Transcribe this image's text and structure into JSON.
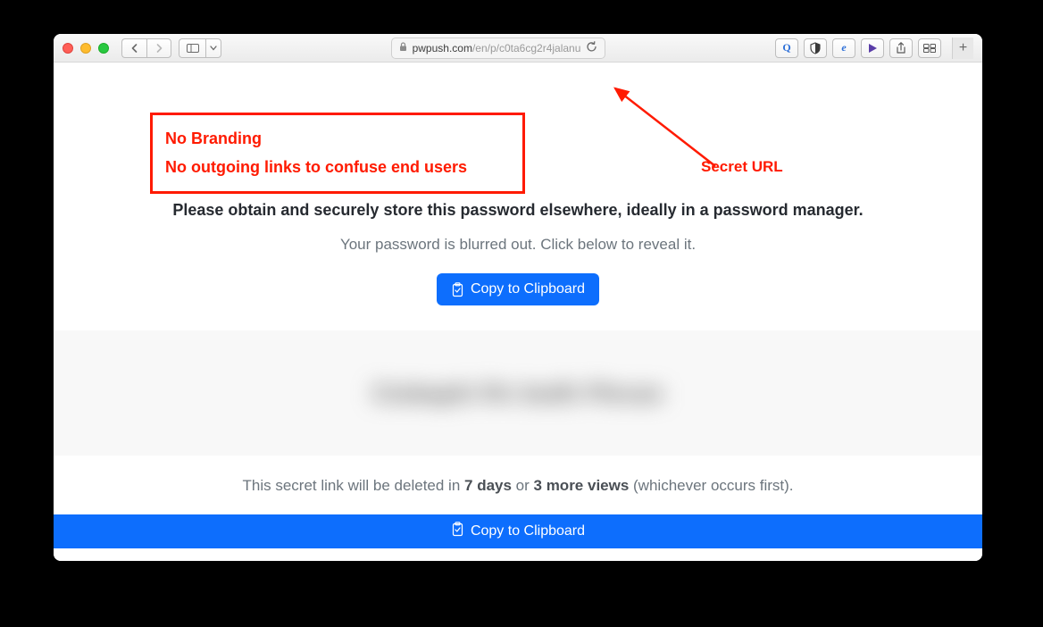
{
  "browser": {
    "url_domain": "pwpush.com",
    "url_path": "/en/p/c0ta6cg2r4jalanu",
    "extensions": {
      "q": "Q",
      "e": "e",
      "play": "▶"
    }
  },
  "page": {
    "heading": "Please obtain and securely store this password elsewhere, ideally in a password manager.",
    "sub": "Your password is blurred out. Click below to reveal it.",
    "copy_btn_label": "Copy to Clipboard",
    "blurred_placeholder": "Ctobaphi Rn bedh Plevan",
    "footnote_pre": "This secret link will be deleted in ",
    "footnote_days": "7 days",
    "footnote_or": " or ",
    "footnote_views": "3 more views",
    "footnote_post": " (whichever occurs first).",
    "fullbar_label": "Copy to Clipboard"
  },
  "annotations": {
    "box_line1": "No Branding",
    "box_line2": "No outgoing links to confuse end users",
    "secret_url": "Secret URL"
  }
}
